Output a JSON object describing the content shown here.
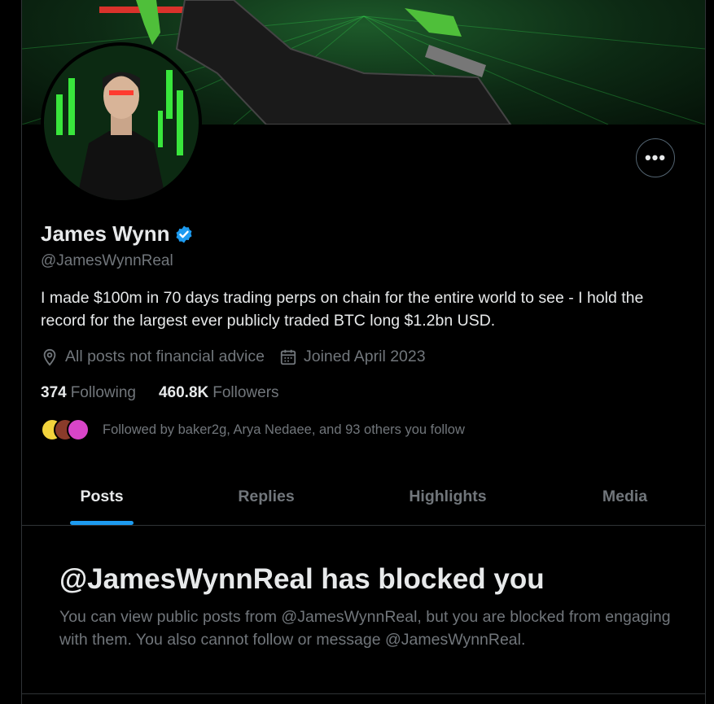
{
  "profile": {
    "name": "James Wynn",
    "handle": "@JamesWynnReal",
    "bio": "I made $100m in 70 days trading perps on chain for the entire world to see - I hold the record for the largest ever publicly traded BTC long $1.2bn USD.",
    "location": "All posts not financial advice",
    "joined": "Joined April 2023",
    "following_count": "374",
    "following_label": "Following",
    "followers_count": "460.8K",
    "followers_label": "Followers",
    "followed_by": "Followed by baker2g, Arya Nedaee, and 93 others you follow",
    "verified_color": "#1d9bf0"
  },
  "more_button": {
    "label": "•••"
  },
  "tabs": [
    {
      "label": "Posts",
      "active": true
    },
    {
      "label": "Replies",
      "active": false
    },
    {
      "label": "Highlights",
      "active": false
    },
    {
      "label": "Media",
      "active": false
    }
  ],
  "blocked": {
    "title": "@JamesWynnReal has blocked you",
    "message": "You can view public posts from @JamesWynnReal, but you are blocked from engaging with them. You also cannot follow or message @JamesWynnReal."
  },
  "colors": {
    "background": "#000000",
    "text_primary": "#e7e9ea",
    "text_secondary": "#71767b",
    "accent": "#1d9bf0",
    "border": "#2f3336"
  }
}
